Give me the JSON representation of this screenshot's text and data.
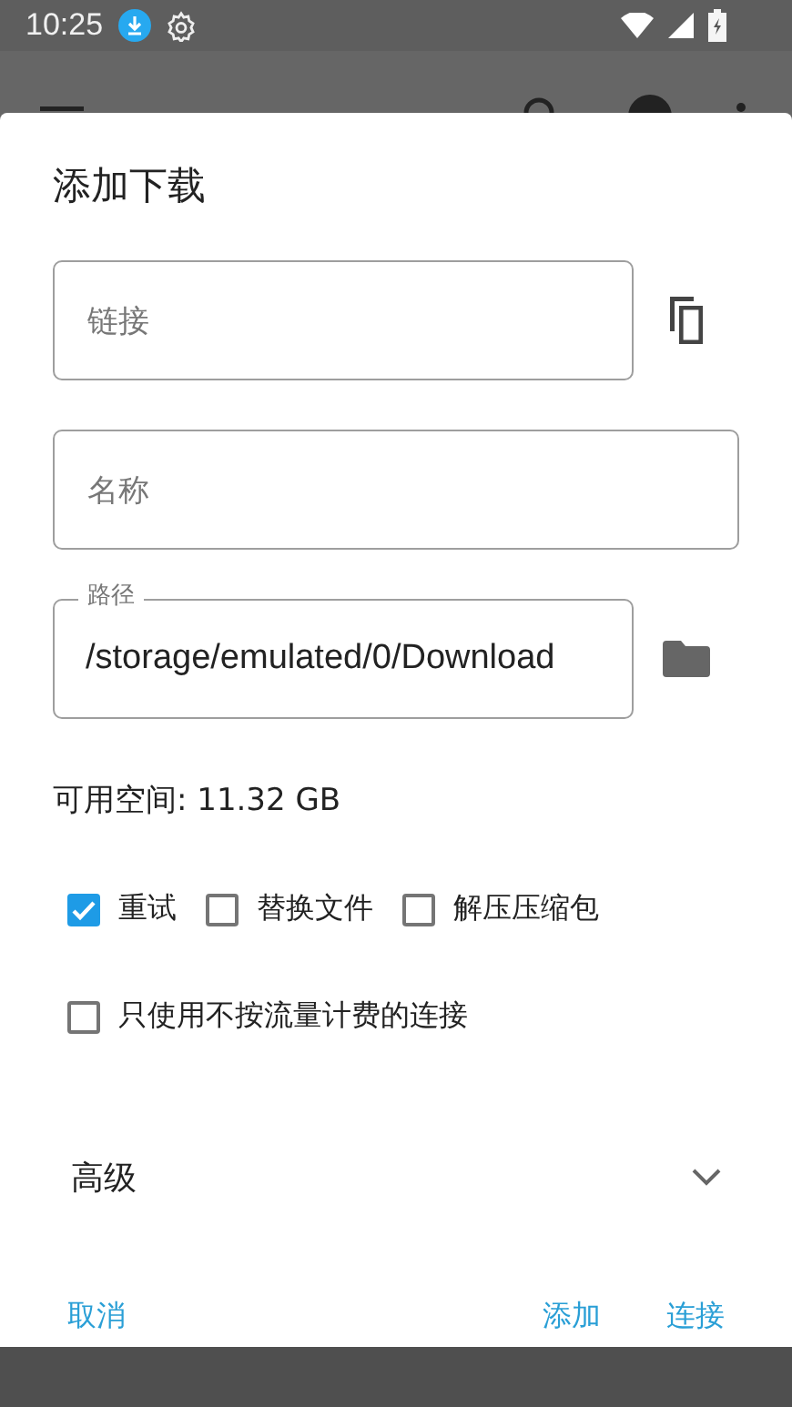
{
  "status_bar": {
    "time": "10:25"
  },
  "dialog": {
    "title": "添加下载",
    "fields": [
      {
        "kind": "link",
        "placeholder": "链接"
      },
      {
        "kind": "text",
        "placeholder": "名称"
      },
      {
        "kind": "path",
        "label": "路径",
        "value": "/storage/emulated/0/Download"
      }
    ],
    "free_space": "可用空间: 11.32 GB",
    "option_rows": [
      [
        {
          "label": "重试",
          "checked": true
        },
        {
          "label": "替换文件",
          "checked": false
        },
        {
          "label": "解压压缩包",
          "checked": false
        }
      ],
      [
        {
          "label": "只使用不按流量计费的连接",
          "checked": false
        }
      ]
    ],
    "advanced": {
      "label": "高级",
      "expanded": false
    },
    "buttons": [
      {
        "label": "取消",
        "kind": "dismiss"
      },
      {
        "label": "添加",
        "kind": "confirm"
      },
      {
        "label": "连接",
        "kind": "confirm"
      }
    ]
  }
}
